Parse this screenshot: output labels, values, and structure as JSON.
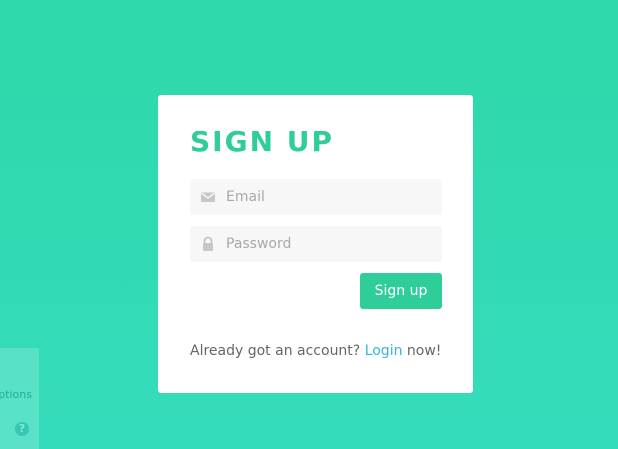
{
  "signup": {
    "title": "SIGN UP",
    "email_placeholder": "Email",
    "email_value": "",
    "password_placeholder": "Password",
    "password_value": "",
    "submit_label": "Sign up",
    "footer_prefix": "Already got an account? ",
    "footer_link": "Login",
    "footer_suffix": " now!"
  },
  "side_widget": {
    "options_text": "ptions",
    "help_icon": "?"
  },
  "colors": {
    "accent": "#2ecd99",
    "link": "#3ab4d6",
    "background_top": "#2ed8a8",
    "background_bottom": "#35dcbc"
  },
  "icons": {
    "email": "envelope-icon",
    "password": "lock-icon",
    "help": "question-icon"
  }
}
